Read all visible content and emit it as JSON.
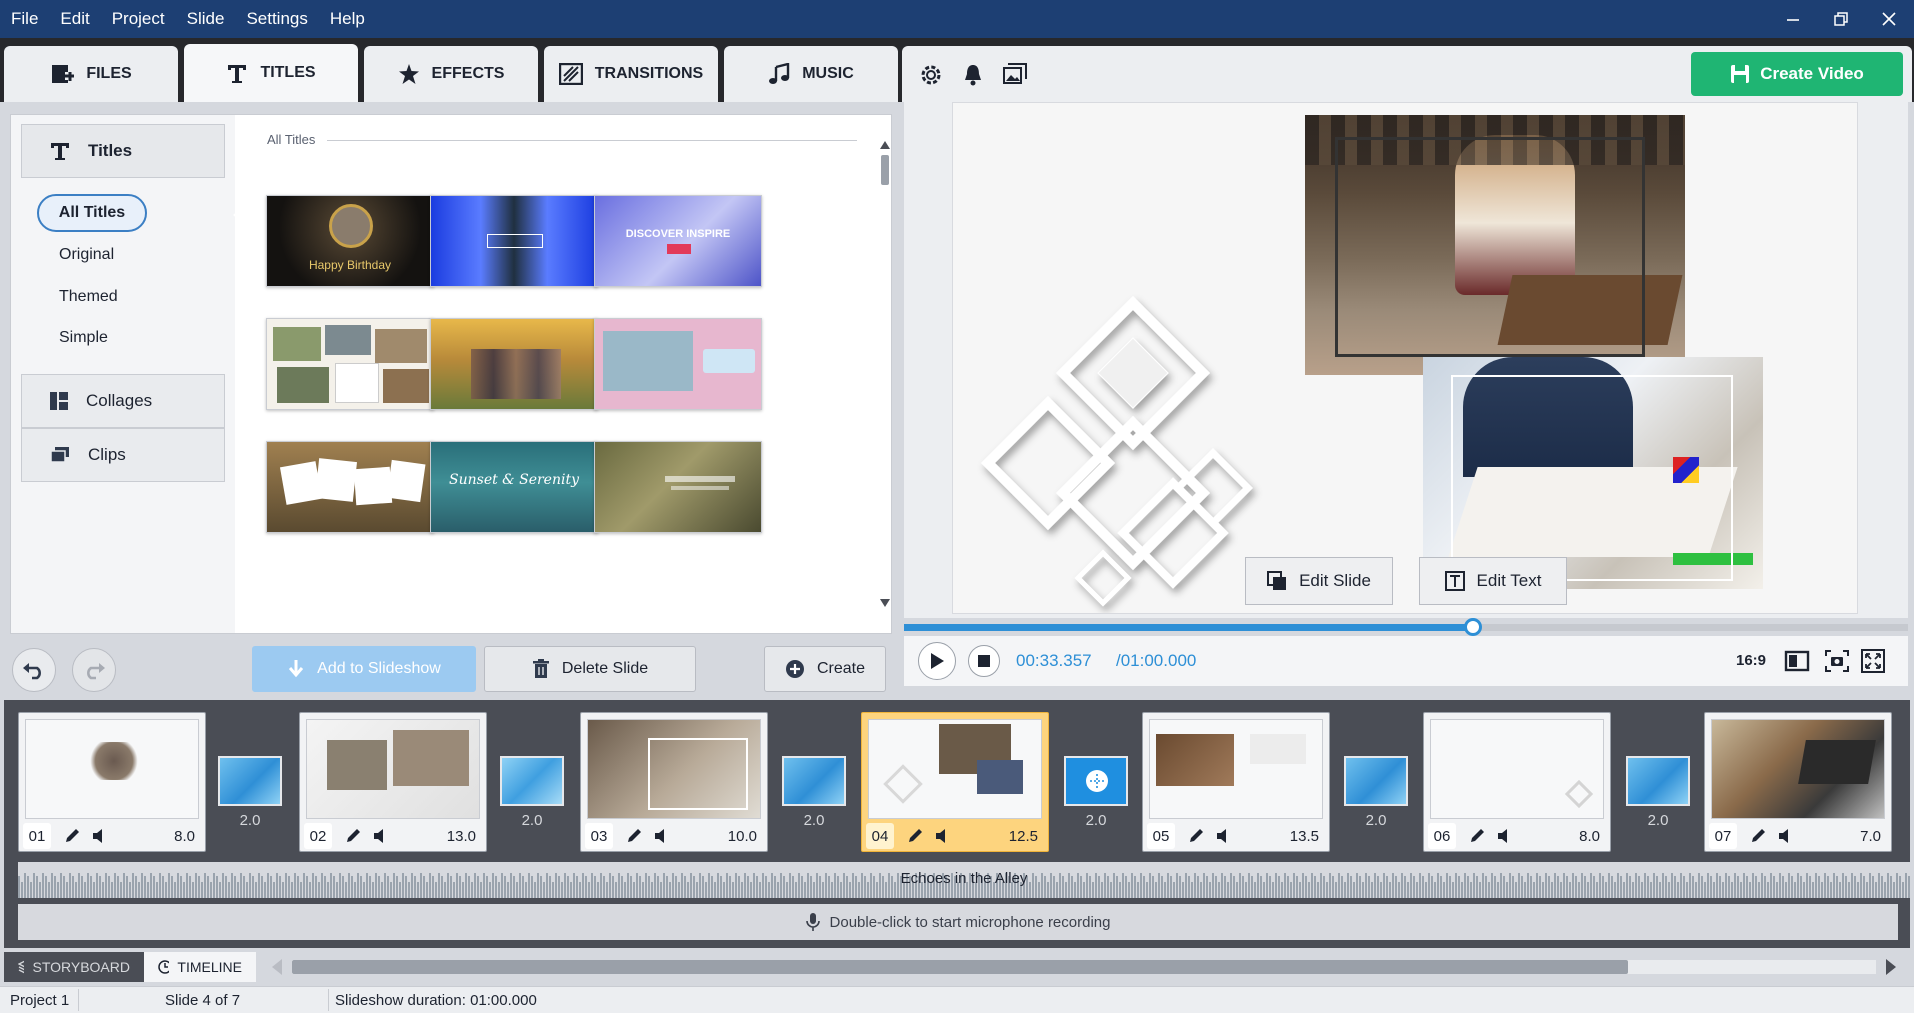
{
  "menubar": {
    "items": [
      "File",
      "Edit",
      "Project",
      "Slide",
      "Settings",
      "Help"
    ]
  },
  "tabs": [
    {
      "label": "FILES",
      "icon": "add-file-icon"
    },
    {
      "label": "TITLES",
      "icon": "title-t-icon",
      "active": true
    },
    {
      "label": "EFFECTS",
      "icon": "effects-star-icon"
    },
    {
      "label": "TRANSITIONS",
      "icon": "transitions-icon"
    },
    {
      "label": "MUSIC",
      "icon": "music-note-icon"
    }
  ],
  "toolbar": {
    "create_video": "Create Video"
  },
  "library": {
    "categories": {
      "titles": "Titles",
      "collages": "Collages",
      "clips": "Clips"
    },
    "subitems": [
      "All Titles",
      "Original",
      "Themed",
      "Simple"
    ],
    "grid_title": "All Titles",
    "thumbs": [
      {
        "caption": "Happy Birthday"
      },
      {
        "caption": ""
      },
      {
        "caption": "DISCOVER INSPIRE"
      },
      {
        "caption": ""
      },
      {
        "caption": ""
      },
      {
        "caption": ""
      },
      {
        "caption": ""
      },
      {
        "caption": "Sunset & Serenity"
      },
      {
        "caption": ""
      }
    ]
  },
  "actions": {
    "add_to_slideshow": "Add to Slideshow",
    "delete_slide": "Delete Slide",
    "create": "Create"
  },
  "preview": {
    "edit_slide": "Edit Slide",
    "edit_text": "Edit Text",
    "time_current": "00:33.357",
    "time_total": "/01:00.000",
    "progress": 0.567,
    "aspect_ratio": "16:9"
  },
  "storyboard": {
    "slides": [
      {
        "num": "01",
        "dur": "8.0"
      },
      {
        "num": "02",
        "dur": "13.0"
      },
      {
        "num": "03",
        "dur": "10.0"
      },
      {
        "num": "04",
        "dur": "12.5",
        "selected": true
      },
      {
        "num": "05",
        "dur": "13.5"
      },
      {
        "num": "06",
        "dur": "8.0"
      },
      {
        "num": "07",
        "dur": "7.0"
      }
    ],
    "transitions": [
      "2.0",
      "2.0",
      "2.0",
      "2.0",
      "2.0",
      "2.0"
    ],
    "audio_track": "Echoes in the Alley",
    "mic_hint": "Double-click to start microphone recording"
  },
  "viewtabs": {
    "storyboard": "STORYBOARD",
    "timeline": "TIMELINE"
  },
  "status": {
    "project": "Project 1",
    "slide": "Slide 4 of 7",
    "duration": "Slideshow duration: 01:00.000"
  },
  "colors": {
    "menubar": "#1d3f73",
    "accent": "#2d8fd6",
    "create": "#1fb573",
    "selected_slide": "#fdd47e"
  }
}
